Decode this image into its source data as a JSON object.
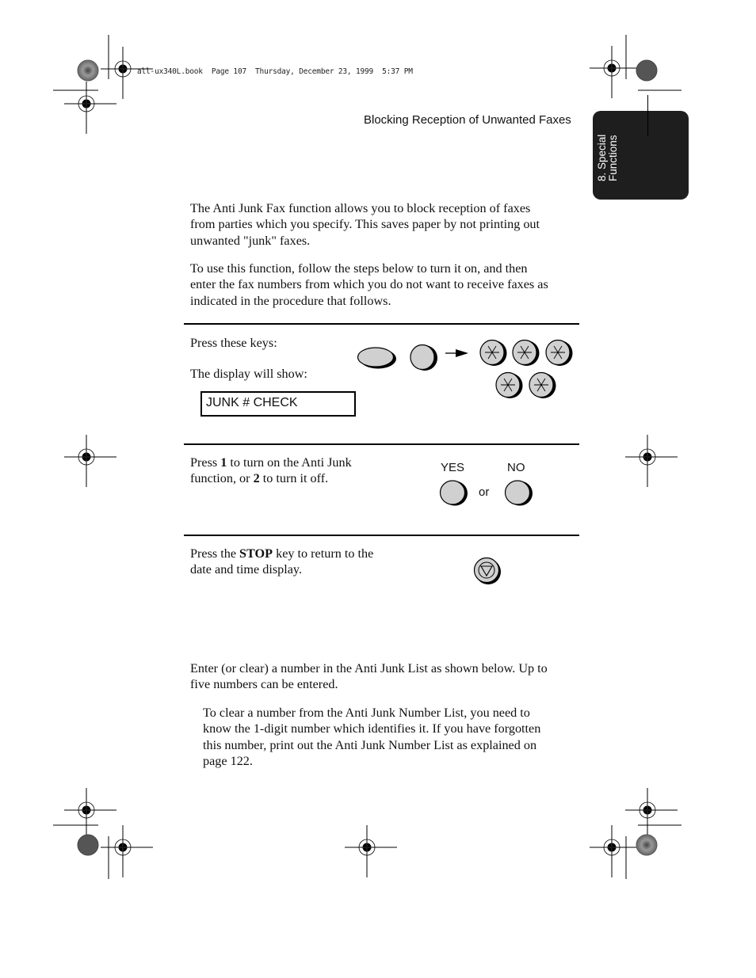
{
  "slug": "all-ux340L.book  Page 107  Thursday, December 23, 1999  5:37 PM",
  "header": {
    "title": "Blocking Reception of Unwanted Faxes"
  },
  "chapter_tab": {
    "line1": "8. Special",
    "line2": "Functions"
  },
  "intro": {
    "para1": [
      "The Anti Junk Fax function allows you to block reception of faxes",
      "from parties which you specify. This saves paper by not printing out",
      "unwanted \"junk\" faxes."
    ],
    "para2": [
      "To use this function, follow the steps below to turn it on, and then",
      "enter the fax numbers from which you do not want to receive faxes as",
      "indicated in the procedure that follows."
    ]
  },
  "steps": [
    {
      "label1": "Press these keys:",
      "label2": "The display will show:",
      "display": "JUNK # CHECK",
      "icons": [
        "function-key-icon",
        "key-icon",
        "arrow-right-icon",
        "star-key-icon",
        "star-key-icon",
        "star-key-icon",
        "star-key-icon",
        "star-key-icon"
      ]
    },
    {
      "pre1": "Press ",
      "bold1": "1",
      "mid1": " to turn on the Anti Junk",
      "pre2": "function, or ",
      "bold2": "2",
      "mid2": " to turn it off.",
      "yes_label": "YES",
      "no_label": "NO",
      "or_label": "or"
    },
    {
      "pre1": "Press the ",
      "bold1": "STOP",
      "mid1": " key to return to the",
      "line2": "date and time display.",
      "icon": "stop-key-icon"
    }
  ],
  "outro": {
    "para1": [
      "Enter (or clear) a number in the Anti Junk List as shown below. Up to",
      "five numbers can be entered."
    ],
    "note": [
      "To clear a number from the Anti Junk Number List, you need to",
      "know the 1-digit number which identifies it. If you have forgotten",
      "this number, print out the Anti Junk Number List as explained on",
      "page 122."
    ]
  }
}
